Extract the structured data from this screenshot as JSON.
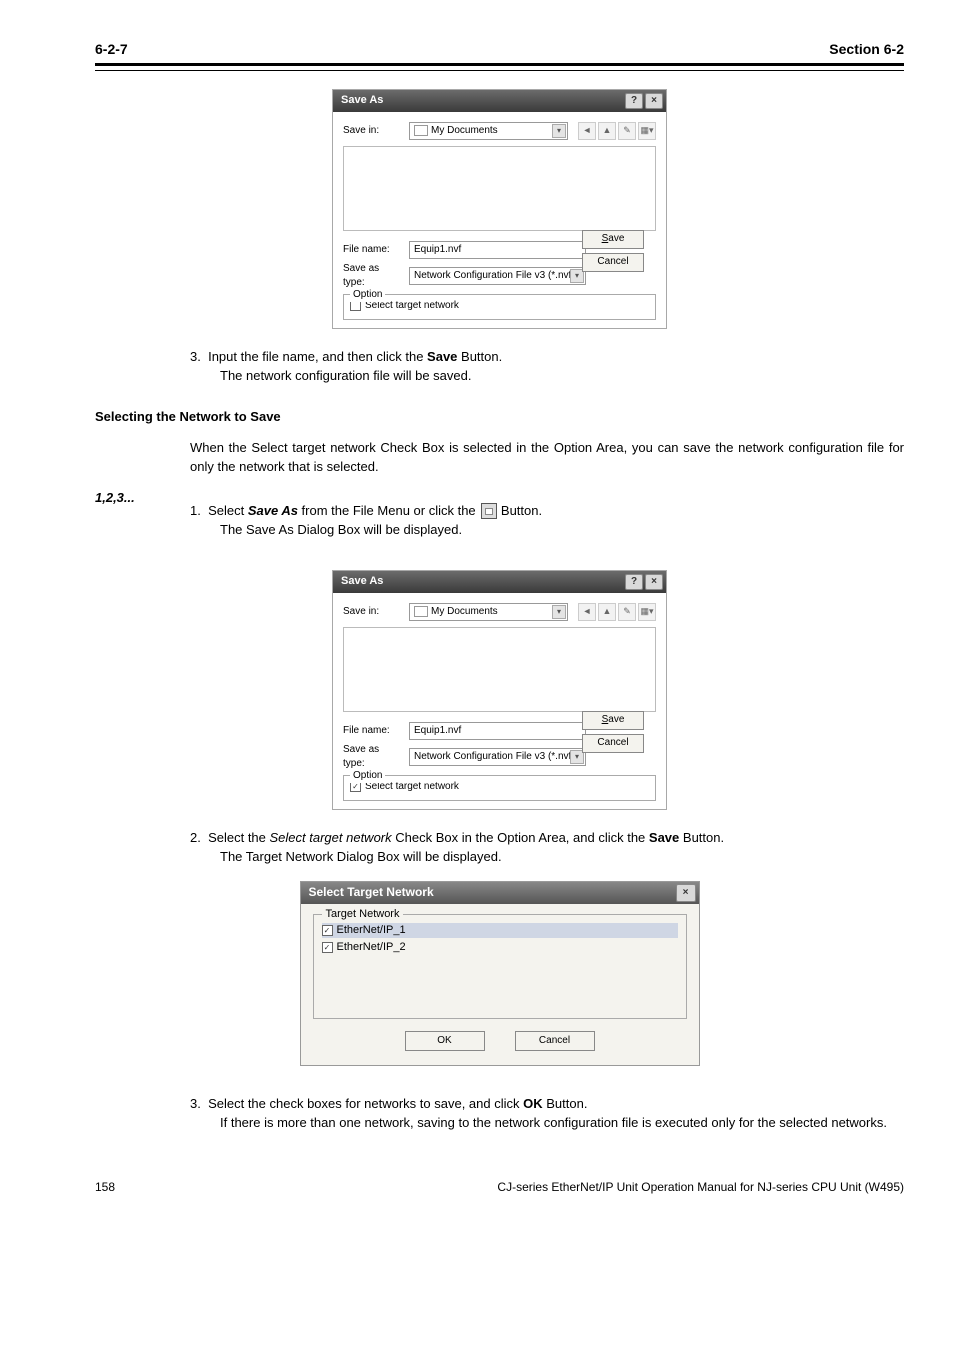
{
  "header": {
    "section": "6-2-7",
    "chapter": "Section 6-2"
  },
  "dialog1": {
    "title": "Save As",
    "savein_label": "Save in:",
    "savein_value": "My Documents",
    "filename_label": "File name:",
    "filename_value": "Equip1.nvf",
    "saveastype_label": "Save as type:",
    "saveastype_value": "Network Configuration File v3 (*.nvf)",
    "save_btn": "Save",
    "cancel_btn": "Cancel",
    "option_legend": "Option",
    "option_checkbox": "Select target network"
  },
  "para1_line1": "Input the file name, and then click the ",
  "para1_bold": "Save",
  "para1_line2": " Button.",
  "para1_line3": "The network configuration file will be saved.",
  "subhead1": "Selecting the Network to Save",
  "para2": "When the Select target network Check Box is selected in the Option Area, you can save the network configuration file for only the network that is selected.",
  "step_prefix": "1,2,3...",
  "step1_num": "1.",
  "step1_text_a": "Select ",
  "step1_text_b": "Save As",
  "step1_text_c": " from the File Menu or click the ",
  "step1_text_d": " Button.",
  "step1_text_e": "The Save As Dialog Box will be displayed.",
  "dialog2": {
    "title": "Save As",
    "option_checked": true
  },
  "step2_num": "2.",
  "step2_text_a": "Select the ",
  "step2_text_b": "Select target network",
  "step2_text_c": " Check Box in the Option Area, and click the",
  "step2_bold": "Save",
  "step2_text_d": " Button.",
  "step2_text_e": "The Target Network Dialog Box will be displayed.",
  "stn_dialog": {
    "title": "Select Target Network",
    "legend": "Target Network",
    "item1": "EtherNet/IP_1",
    "item2": "EtherNet/IP_2",
    "ok": "OK",
    "cancel": "Cancel"
  },
  "step3_num": "3.",
  "step3_text_a": "Select the check boxes for networks to save, and click ",
  "step3_bold": "OK",
  "step3_text_b": " Button.",
  "step3_text_c": "If there is more than one network, saving to the network configuration file is executed only for the selected networks.",
  "footer": {
    "page": "158",
    "doc": "CJ-series EtherNet/IP Unit Operation Manual for NJ-series CPU Unit (W495)"
  }
}
